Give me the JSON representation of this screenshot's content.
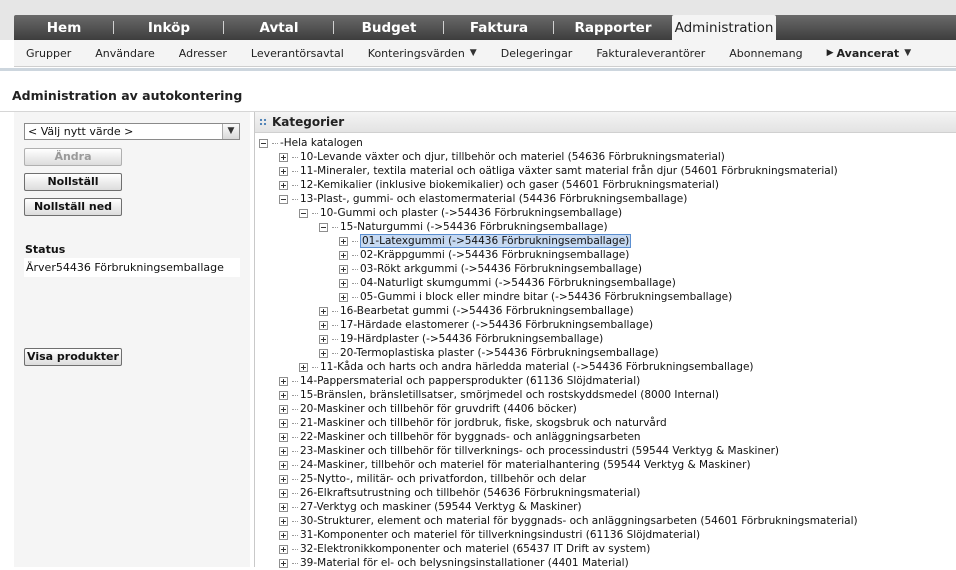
{
  "topnav": {
    "tabs": [
      {
        "label": "Hem",
        "width": 100
      },
      {
        "label": "Inköp",
        "width": 110
      },
      {
        "label": "Avtal",
        "width": 110
      },
      {
        "label": "Budget",
        "width": 110
      },
      {
        "label": "Faktura",
        "width": 110
      },
      {
        "label": "Rapporter",
        "width": 118
      },
      {
        "label": "Administration",
        "width": 104,
        "active": true
      }
    ]
  },
  "subnav": {
    "items": [
      {
        "label": "Grupper"
      },
      {
        "label": "Användare"
      },
      {
        "label": "Adresser"
      },
      {
        "label": "Leverantörsavtal"
      },
      {
        "label": "Konteringsvärden",
        "dropdown": true
      },
      {
        "label": "Delegeringar"
      },
      {
        "label": "Fakturaleverantörer"
      },
      {
        "label": "Abonnemang"
      },
      {
        "label": "Avancerat",
        "dropdown": true,
        "bold": true,
        "prefix": "▶"
      }
    ]
  },
  "page": {
    "title": "Administration av autokontering"
  },
  "left": {
    "select_value": "< Välj nytt värde >",
    "buttons": {
      "change": "Ändra",
      "reset": "Nollställ",
      "reset_down": "Nollställ ned",
      "show_products": "Visa produkter"
    },
    "status_label": "Status",
    "status_value": "Ärver54436 Förbrukningsemballage"
  },
  "categories": {
    "title": "Kategorier",
    "nodes": [
      {
        "level": 0,
        "state": "open",
        "label": "-Hela katalogen"
      },
      {
        "level": 1,
        "state": "closed",
        "label": "10-Levande växter och djur, tillbehör och materiel (54636 Förbrukningsmaterial)"
      },
      {
        "level": 1,
        "state": "closed",
        "label": "11-Mineraler, textila material och oätliga växter samt material från djur (54601 Förbrukningsmaterial)"
      },
      {
        "level": 1,
        "state": "closed",
        "label": "12-Kemikalier (inklusive biokemikalier) och gaser (54601 Förbrukningsmaterial)"
      },
      {
        "level": 1,
        "state": "open",
        "label": "13-Plast-, gummi- och elastomermaterial (54436 Förbrukningsemballage)"
      },
      {
        "level": 2,
        "state": "open",
        "label": "10-Gummi och plaster (->54436 Förbrukningsemballage)"
      },
      {
        "level": 3,
        "state": "open",
        "label": "15-Naturgummi (->54436 Förbrukningsemballage)"
      },
      {
        "level": 4,
        "state": "closed",
        "label": "01-Latexgummi (->54436 Förbrukningsemballage)",
        "selected": true
      },
      {
        "level": 4,
        "state": "closed",
        "label": "02-Kräppgummi (->54436 Förbrukningsemballage)"
      },
      {
        "level": 4,
        "state": "closed",
        "label": "03-Rökt arkgummi (->54436 Förbrukningsemballage)"
      },
      {
        "level": 4,
        "state": "closed",
        "label": "04-Naturligt skumgummi (->54436 Förbrukningsemballage)"
      },
      {
        "level": 4,
        "state": "closed",
        "label": "05-Gummi i block eller mindre bitar (->54436 Förbrukningsemballage)"
      },
      {
        "level": 3,
        "state": "closed",
        "label": "16-Bearbetat gummi (->54436 Förbrukningsemballage)"
      },
      {
        "level": 3,
        "state": "closed",
        "label": "17-Härdade elastomerer (->54436 Förbrukningsemballage)"
      },
      {
        "level": 3,
        "state": "closed",
        "label": "19-Härdplaster (->54436 Förbrukningsemballage)"
      },
      {
        "level": 3,
        "state": "closed",
        "label": "20-Termoplastiska plaster (->54436 Förbrukningsemballage)"
      },
      {
        "level": 2,
        "state": "closed",
        "label": "11-Kåda och harts och andra härledda material (->54436 Förbrukningsemballage)"
      },
      {
        "level": 1,
        "state": "closed",
        "label": "14-Pappersmaterial och pappersprodukter (61136 Slöjdmaterial)"
      },
      {
        "level": 1,
        "state": "closed",
        "label": "15-Bränslen, bränsletillsatser, smörjmedel och rostskyddsmedel (8000 Internal)"
      },
      {
        "level": 1,
        "state": "closed",
        "label": "20-Maskiner och tillbehör för gruvdrift (4406 böcker)"
      },
      {
        "level": 1,
        "state": "closed",
        "label": "21-Maskiner och tillbehör för jordbruk, fiske, skogsbruk och naturvård"
      },
      {
        "level": 1,
        "state": "closed",
        "label": "22-Maskiner och tillbehör för byggnads- och anläggningsarbeten"
      },
      {
        "level": 1,
        "state": "closed",
        "label": "23-Maskiner och tillbehör för tillverknings- och processindustri (59544 Verktyg & Maskiner)"
      },
      {
        "level": 1,
        "state": "closed",
        "label": "24-Maskiner, tillbehör och materiel för materialhantering (59544 Verktyg & Maskiner)"
      },
      {
        "level": 1,
        "state": "closed",
        "label": "25-Nytto-, militär- och privatfordon, tillbehör och delar"
      },
      {
        "level": 1,
        "state": "closed",
        "label": "26-Elkraftsutrustning och tillbehör (54636 Förbrukningsmaterial)"
      },
      {
        "level": 1,
        "state": "closed",
        "label": "27-Verktyg och maskiner (59544 Verktyg & Maskiner)"
      },
      {
        "level": 1,
        "state": "closed",
        "label": "30-Strukturer, element och material för byggnads- och anläggningsarbeten (54601 Förbrukningsmaterial)"
      },
      {
        "level": 1,
        "state": "closed",
        "label": "31-Komponenter och materiel för tillverkningsindustri (61136 Slöjdmaterial)"
      },
      {
        "level": 1,
        "state": "closed",
        "label": "32-Elektronikkomponenter och materiel (65437 IT Drift av system)"
      },
      {
        "level": 1,
        "state": "closed",
        "label": "39-Material för el- och belysningsinstallationer (4401 Material)"
      }
    ]
  }
}
